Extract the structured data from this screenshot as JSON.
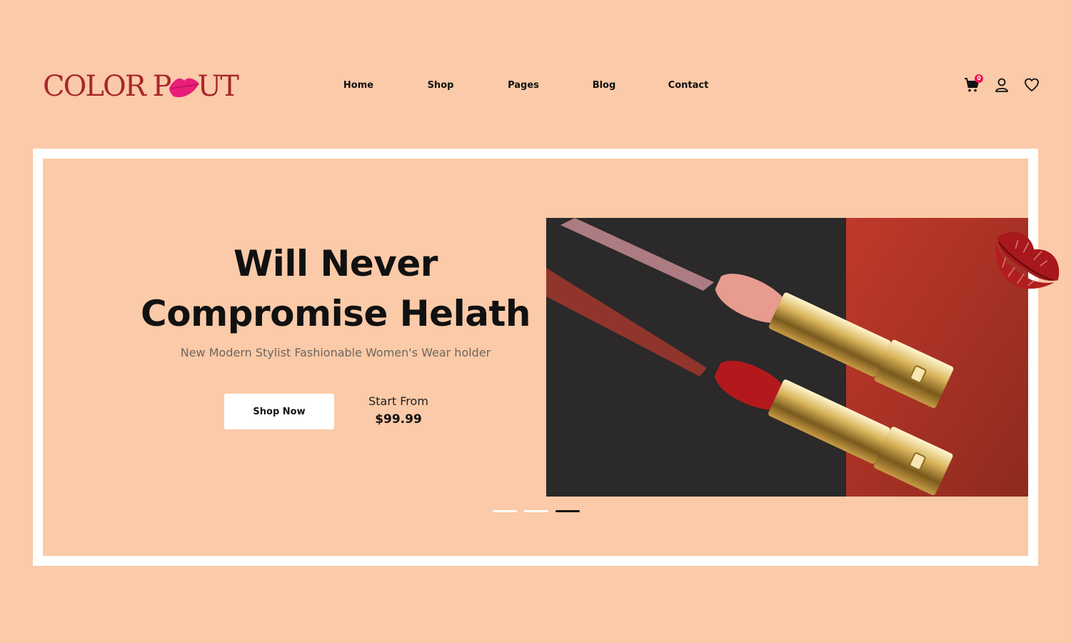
{
  "brand": {
    "logo_text_left": "COLOR P",
    "logo_text_right": "UT",
    "logo_accent_color": "#e91e7a"
  },
  "nav": [
    {
      "label": "Home",
      "name": "nav-home"
    },
    {
      "label": "Shop",
      "name": "nav-shop"
    },
    {
      "label": "Pages",
      "name": "nav-pages"
    },
    {
      "label": "Blog",
      "name": "nav-blog"
    },
    {
      "label": "Contact",
      "name": "nav-contact"
    }
  ],
  "header_icons": {
    "cart": "cart-icon",
    "cart_count": "0",
    "user": "user-icon",
    "wishlist": "heart-icon"
  },
  "hero": {
    "headline_line1": "Will Never",
    "headline_line2": "Compromise Helath",
    "subtitle": "New Modern Stylist Fashionable Women's Wear holder",
    "cta_label": "Shop Now",
    "price_label": "Start From",
    "price_value": "$99.99"
  },
  "slider": {
    "slides": 3,
    "active_index": 2
  },
  "colors": {
    "background": "#fbcaa8",
    "brand_red": "#a8272b",
    "badge": "#e8194f"
  }
}
